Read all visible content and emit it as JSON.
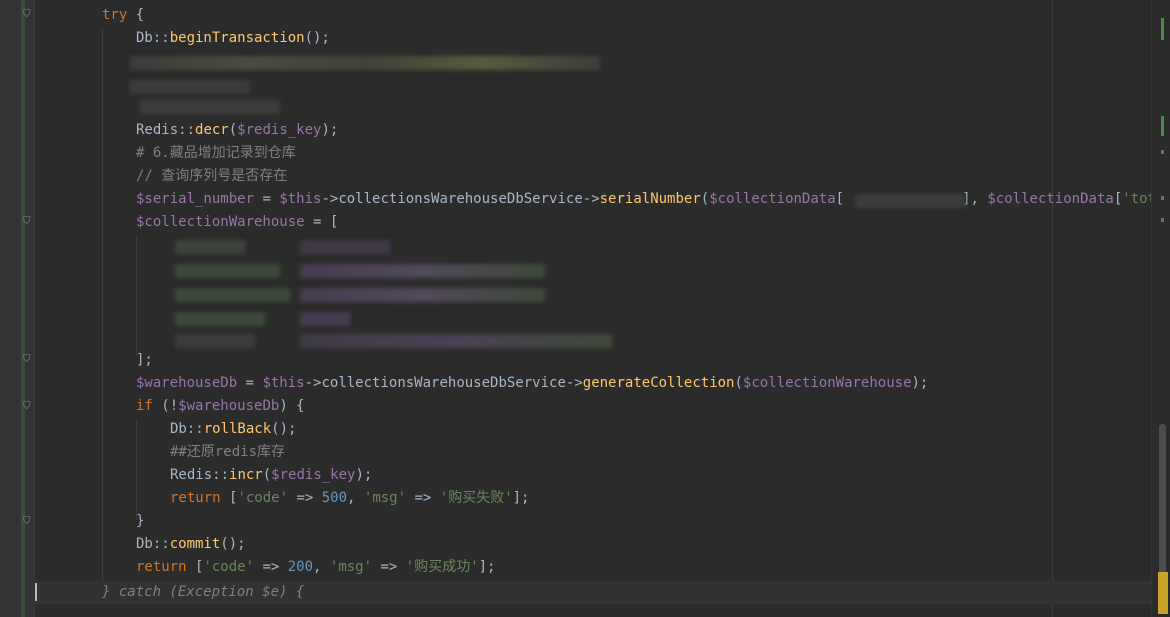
{
  "editor": {
    "language": "php",
    "theme_colors": {
      "background": "#2b2b2b",
      "gutter": "#313335",
      "keyword": "#cc7832",
      "function": "#ffc66d",
      "variable": "#9876aa",
      "string": "#6a8759",
      "number": "#6897bb",
      "comment": "#808080",
      "plain": "#a9b7c6"
    },
    "lines": [
      {
        "segments": [
          {
            "t": "kw",
            "v": "try"
          },
          {
            "t": "p",
            "v": " {"
          }
        ]
      },
      {
        "segments": [
          {
            "t": "p",
            "v": "Db::"
          },
          {
            "t": "fn",
            "v": "beginTransaction"
          },
          {
            "t": "p",
            "v": "();"
          }
        ]
      },
      {
        "segments": []
      },
      {
        "segments": []
      },
      {
        "segments": []
      },
      {
        "segments": [
          {
            "t": "p",
            "v": "Redis::"
          },
          {
            "t": "fn",
            "v": "decr"
          },
          {
            "t": "p",
            "v": "("
          },
          {
            "t": "var",
            "v": "$redis_key"
          },
          {
            "t": "p",
            "v": ");"
          }
        ]
      },
      {
        "segments": [
          {
            "t": "cmt",
            "v": "# 6.藏品增加记录到仓库"
          }
        ]
      },
      {
        "segments": [
          {
            "t": "cmt",
            "v": "// 查询序列号是否存在"
          }
        ]
      },
      {
        "segments": [
          {
            "t": "var",
            "v": "$serial_number"
          },
          {
            "t": "p",
            "v": " = "
          },
          {
            "t": "var",
            "v": "$this"
          },
          {
            "t": "p",
            "v": "->collectionsWarehouseDbService->"
          },
          {
            "t": "fn",
            "v": "serialNumber"
          },
          {
            "t": "p",
            "v": "("
          },
          {
            "t": "var",
            "v": "$collectionData"
          },
          {
            "t": "p",
            "v": "[              ], "
          },
          {
            "t": "var",
            "v": "$collectionData"
          },
          {
            "t": "p",
            "v": "["
          },
          {
            "t": "str",
            "v": "'tota"
          }
        ]
      },
      {
        "segments": [
          {
            "t": "var",
            "v": "$collectionWarehouse"
          },
          {
            "t": "p",
            "v": " = ["
          }
        ]
      },
      {
        "segments": []
      },
      {
        "segments": []
      },
      {
        "segments": []
      },
      {
        "segments": []
      },
      {
        "segments": []
      },
      {
        "segments": [
          {
            "t": "p",
            "v": "];"
          }
        ]
      },
      {
        "segments": [
          {
            "t": "var",
            "v": "$warehouseDb"
          },
          {
            "t": "p",
            "v": " = "
          },
          {
            "t": "var",
            "v": "$this"
          },
          {
            "t": "p",
            "v": "->collectionsWarehouseDbService->"
          },
          {
            "t": "fn",
            "v": "generateCollection"
          },
          {
            "t": "p",
            "v": "("
          },
          {
            "t": "var",
            "v": "$collectionWarehouse"
          },
          {
            "t": "p",
            "v": ");"
          }
        ]
      },
      {
        "segments": [
          {
            "t": "kw",
            "v": "if"
          },
          {
            "t": "p",
            "v": " (!"
          },
          {
            "t": "var",
            "v": "$warehouseDb"
          },
          {
            "t": "p",
            "v": ") {"
          }
        ]
      },
      {
        "segments": [
          {
            "t": "p",
            "v": "Db::"
          },
          {
            "t": "fn",
            "v": "rollBack"
          },
          {
            "t": "p",
            "v": "();"
          }
        ]
      },
      {
        "segments": [
          {
            "t": "cmt",
            "v": "##还原redis库存"
          }
        ]
      },
      {
        "segments": [
          {
            "t": "p",
            "v": "Redis::"
          },
          {
            "t": "fn",
            "v": "incr"
          },
          {
            "t": "p",
            "v": "("
          },
          {
            "t": "var",
            "v": "$redis_key"
          },
          {
            "t": "p",
            "v": ");"
          }
        ]
      },
      {
        "segments": [
          {
            "t": "kw",
            "v": "return"
          },
          {
            "t": "p",
            "v": " ["
          },
          {
            "t": "str",
            "v": "'code'"
          },
          {
            "t": "p",
            "v": " => "
          },
          {
            "t": "num",
            "v": "500"
          },
          {
            "t": "p",
            "v": ", "
          },
          {
            "t": "str",
            "v": "'msg'"
          },
          {
            "t": "p",
            "v": " => "
          },
          {
            "t": "str",
            "v": "'购买失败'"
          },
          {
            "t": "p",
            "v": "];"
          }
        ]
      },
      {
        "segments": [
          {
            "t": "p",
            "v": "}"
          }
        ]
      },
      {
        "segments": [
          {
            "t": "p",
            "v": "Db::"
          },
          {
            "t": "fn",
            "v": "commit"
          },
          {
            "t": "p",
            "v": "();"
          }
        ]
      },
      {
        "segments": [
          {
            "t": "kw",
            "v": "return"
          },
          {
            "t": "p",
            "v": " ["
          },
          {
            "t": "str",
            "v": "'code'"
          },
          {
            "t": "p",
            "v": " => "
          },
          {
            "t": "num",
            "v": "200"
          },
          {
            "t": "p",
            "v": ", "
          },
          {
            "t": "str",
            "v": "'msg'"
          },
          {
            "t": "p",
            "v": " => "
          },
          {
            "t": "str",
            "v": "'购买成功'"
          },
          {
            "t": "p",
            "v": "];"
          }
        ]
      },
      {
        "segments": [
          {
            "t": "italic",
            "v": "} catch (Exception $e) {"
          }
        ]
      }
    ]
  }
}
